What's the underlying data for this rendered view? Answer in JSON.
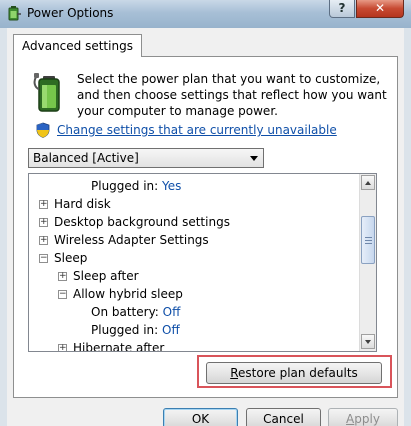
{
  "window": {
    "title": "Power Options",
    "help_label": "?",
    "close_label": "✕"
  },
  "tab": {
    "label": "Advanced settings"
  },
  "intro": {
    "text": "Select the power plan that you want to customize, and then choose settings that reflect how you want your computer to manage power."
  },
  "change_link": "Change settings that are currently unavailable",
  "plan_select": {
    "selected": "Balanced [Active]"
  },
  "tree": {
    "rows": [
      {
        "label": "Plugged in:",
        "value": "Yes"
      },
      {
        "label": "Hard disk",
        "toggle": "+"
      },
      {
        "label": "Desktop background settings",
        "toggle": "+"
      },
      {
        "label": "Wireless Adapter Settings",
        "toggle": "+"
      },
      {
        "label": "Sleep",
        "toggle": "−"
      },
      {
        "label": "Sleep after",
        "toggle": "+"
      },
      {
        "label": "Allow hybrid sleep",
        "toggle": "−"
      },
      {
        "label": "On battery:",
        "value": "Off"
      },
      {
        "label": "Plugged in:",
        "value": "Off"
      },
      {
        "label": "Hibernate after",
        "toggle": "+"
      }
    ]
  },
  "buttons": {
    "restore": "Restore plan defaults",
    "ok": "OK",
    "cancel": "Cancel",
    "apply": "Apply"
  },
  "colors": {
    "link": "#0f4fa8",
    "highlight": "#d9545a"
  },
  "icons": {
    "title": "power-options-icon",
    "battery": "battery-plug-icon",
    "shield": "uac-shield-icon"
  }
}
